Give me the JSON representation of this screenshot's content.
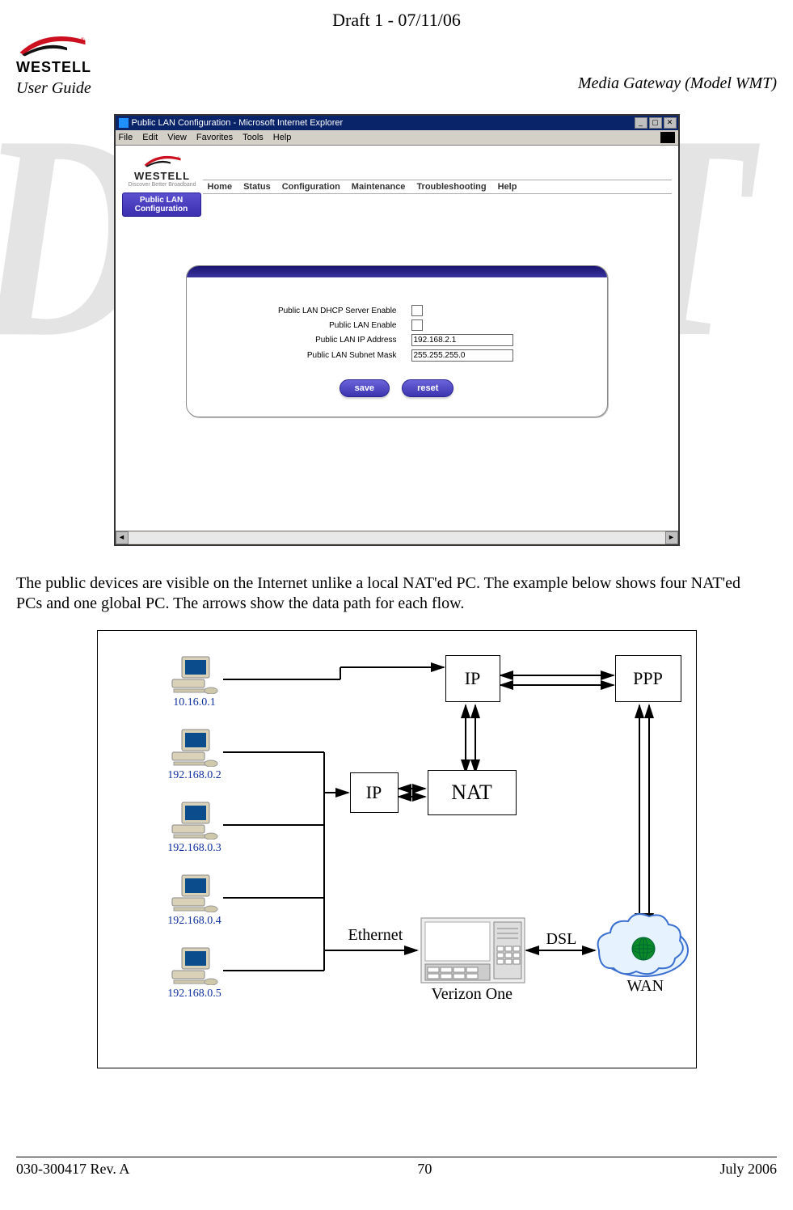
{
  "header": {
    "draft": "Draft 1 - 07/11/06",
    "user_guide": "User Guide",
    "model": "Media Gateway (Model WMT)",
    "logo_text": "WESTELL"
  },
  "ie": {
    "title": "Public LAN Configuration - Microsoft Internet Explorer",
    "menus": [
      "File",
      "Edit",
      "View",
      "Favorites",
      "Tools",
      "Help"
    ],
    "min": "_",
    "max": "▢",
    "close": "✕"
  },
  "router": {
    "brand": "WESTELL",
    "tagline": "Discover Better Broadband",
    "nav": [
      "Home",
      "Status",
      "Configuration",
      "Maintenance",
      "Troubleshooting",
      "Help"
    ],
    "side_button": "Public LAN Configuration",
    "form": {
      "dhcp_label": "Public LAN DHCP Server Enable",
      "enable_label": "Public LAN Enable",
      "ip_label": "Public LAN IP Address",
      "ip_value": "192.168.2.1",
      "mask_label": "Public LAN Subnet Mask",
      "mask_value": "255.255.255.0",
      "save": "save",
      "reset": "reset"
    }
  },
  "paragraph": "The public devices are visible on the Internet unlike a local NAT'ed PC. The example below shows four NAT'ed PCs and one global PC. The arrows show the data path for each flow.",
  "diagram": {
    "pcs": [
      {
        "ip": "10.16.0.1"
      },
      {
        "ip": "192.168.0.2"
      },
      {
        "ip": "192.168.0.3"
      },
      {
        "ip": "192.168.0.4"
      },
      {
        "ip": "192.168.0.5"
      }
    ],
    "boxes": {
      "ip_top": "IP",
      "ppp": "PPP",
      "ip_left": "IP",
      "nat": "NAT"
    },
    "labels": {
      "ethernet": "Ethernet",
      "verizon": "Verizon One",
      "dsl": "DSL",
      "wan": "WAN"
    }
  },
  "footer": {
    "left": "030-300417 Rev. A",
    "center": "70",
    "right": "July 2006"
  },
  "watermark": "DRAFT"
}
